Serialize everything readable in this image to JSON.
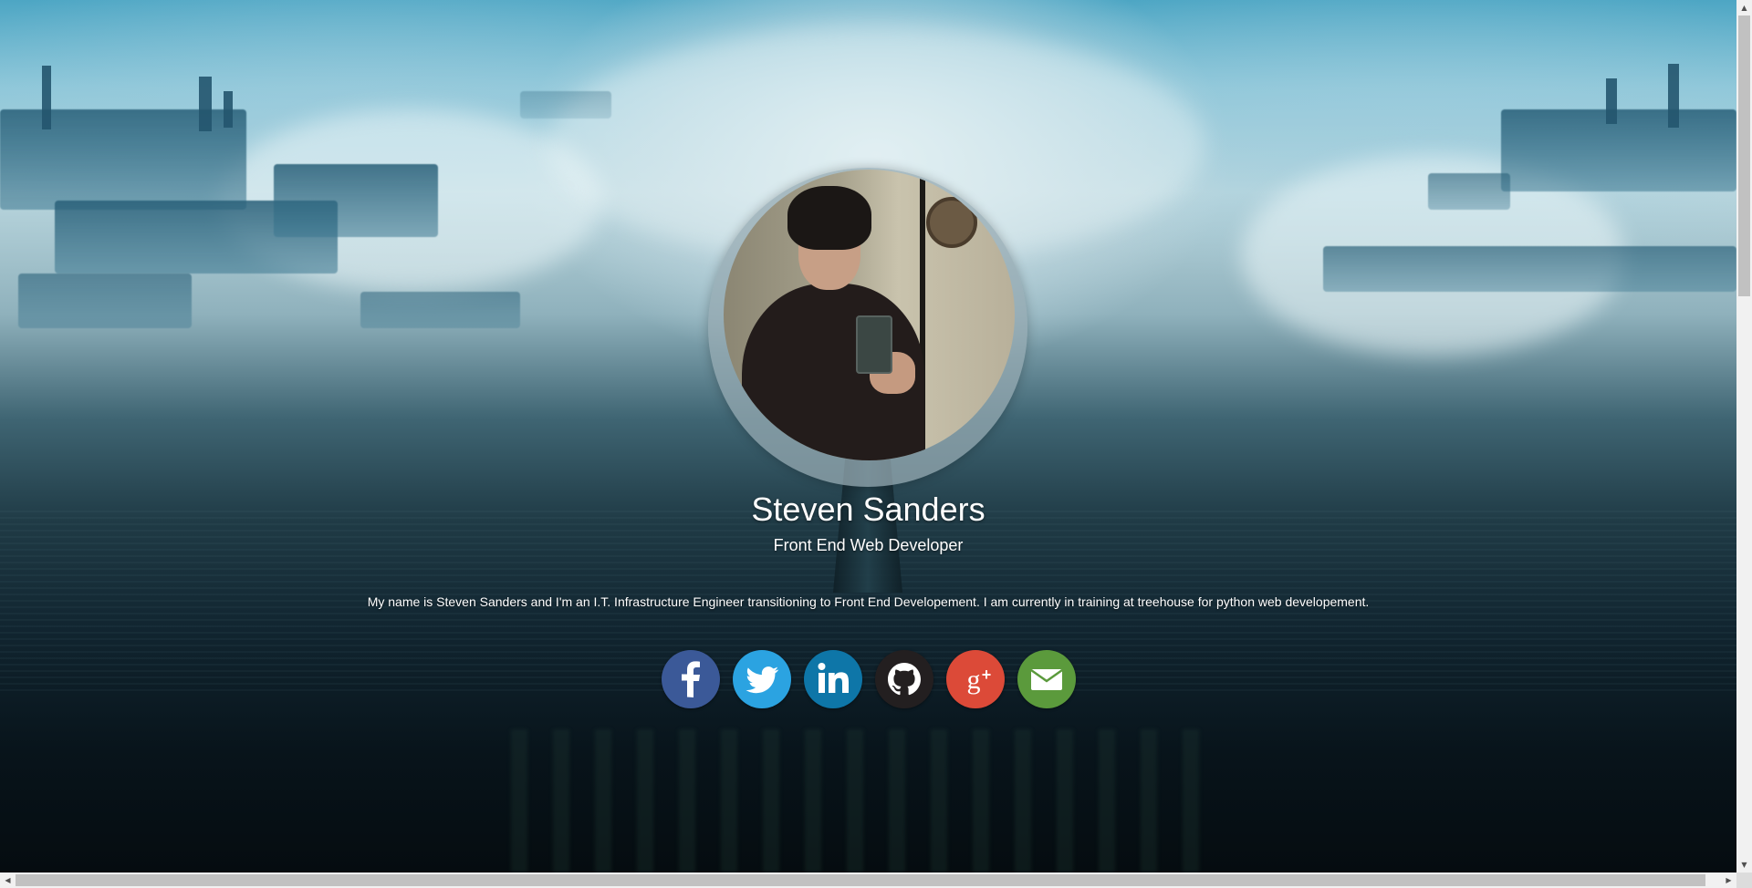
{
  "profile": {
    "name": "Steven Sanders",
    "title": "Front End Web Developer",
    "bio": "My name is Steven Sanders and I'm an I.T. Infrastructure Engineer transitioning to Front End Developement. I am currently in training at treehouse for python web developement."
  },
  "social": [
    {
      "name": "facebook",
      "icon": "facebook-icon",
      "color": "#3b5998"
    },
    {
      "name": "twitter",
      "icon": "twitter-icon",
      "color": "#2ba3e1"
    },
    {
      "name": "linkedin",
      "icon": "linkedin-icon",
      "color": "#0e76a8"
    },
    {
      "name": "github",
      "icon": "github-icon",
      "color": "#231f20"
    },
    {
      "name": "google-plus",
      "icon": "google-plus-icon",
      "color": "#dc4a38"
    },
    {
      "name": "email",
      "icon": "email-icon",
      "color": "#5b9a3c"
    }
  ],
  "scrollbars": {
    "up_arrow": "▲",
    "down_arrow": "▼",
    "left_arrow": "◀",
    "right_arrow": "▶"
  }
}
